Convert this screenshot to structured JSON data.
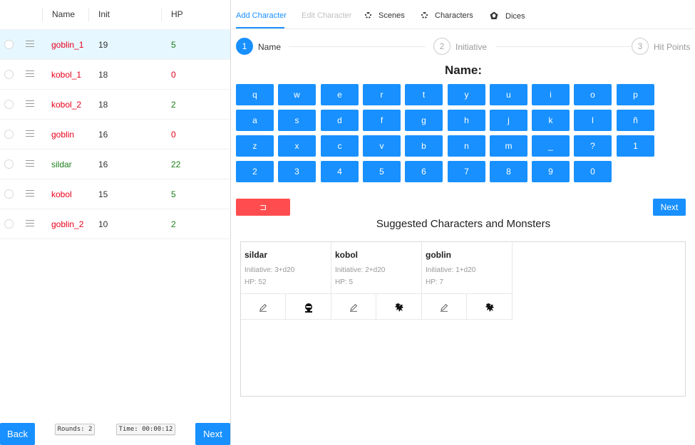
{
  "table": {
    "columns": {
      "name": "Name",
      "init": "Init",
      "hp": "HP"
    },
    "rows": [
      {
        "name": "goblin_1",
        "init": "19",
        "hp": "5",
        "selected": true
      },
      {
        "name": "kobol_1",
        "init": "18",
        "hp": "0"
      },
      {
        "name": "kobol_2",
        "init": "18",
        "hp": "2"
      },
      {
        "name": "goblin",
        "init": "16",
        "hp": "0"
      },
      {
        "name": "sildar",
        "init": "16",
        "hp": "22"
      },
      {
        "name": "kobol",
        "init": "15",
        "hp": "5"
      },
      {
        "name": "goblin_2",
        "init": "10",
        "hp": "2"
      }
    ]
  },
  "footer": {
    "back_label": "Back",
    "rounds": "Rounds: 2",
    "time": "Time: 00:00:12",
    "next_label": "Next"
  },
  "tabs": [
    {
      "label": "Add Character",
      "state": "active"
    },
    {
      "label": "Edit Character",
      "state": "disabled"
    },
    {
      "label": "Scenes",
      "icon": "gear-icon"
    },
    {
      "label": "Characters",
      "icon": "gear-icon"
    },
    {
      "label": "Dices",
      "icon": "dice-icon"
    }
  ],
  "steps": [
    {
      "number": "1",
      "label": "Name",
      "state": "active"
    },
    {
      "number": "2",
      "label": "Initiative",
      "state": "wait"
    },
    {
      "number": "3",
      "label": "Hit Points",
      "state": "wait"
    }
  ],
  "keyboard": {
    "title": "Name:",
    "keys": [
      "q",
      "w",
      "e",
      "r",
      "t",
      "y",
      "u",
      "i",
      "o",
      "p",
      "a",
      "s",
      "d",
      "f",
      "g",
      "h",
      "j",
      "k",
      "l",
      "ñ",
      "z",
      "x",
      "c",
      "v",
      "b",
      "n",
      "m",
      "_",
      "?",
      "1",
      "2",
      "3",
      "4",
      "5",
      "6",
      "7",
      "8",
      "9",
      "0"
    ],
    "backspace_label": "⊐",
    "next_label": "Next"
  },
  "suggestions": {
    "title": "Suggested Characters and Monsters",
    "cards": [
      {
        "name": "sildar",
        "initiative": "Initiative: 3+d20",
        "hp": "HP: 52",
        "icon": "warrior-icon"
      },
      {
        "name": "kobol",
        "initiative": "Initiative: 2+d20",
        "hp": "HP: 5",
        "icon": "dragon-icon"
      },
      {
        "name": "goblin",
        "initiative": "Initiative: 1+d20",
        "hp": "HP: 7",
        "icon": "dragon-icon"
      }
    ]
  },
  "colors": {
    "primary": "#1890ff",
    "danger": "#ff4d4f",
    "hp_red": "#e8001c",
    "hp_green": "#1a7f1a",
    "selected_row": "#e6f7ff"
  }
}
